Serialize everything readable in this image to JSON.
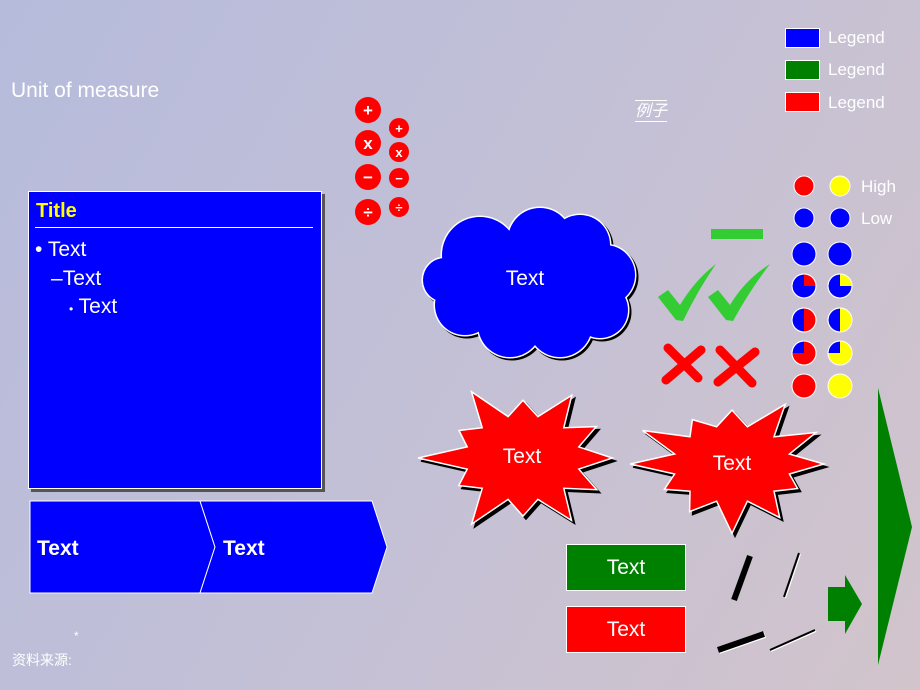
{
  "unit_of_measure": "Unit of measure",
  "example_label": "例子",
  "legend": [
    {
      "label": "Legend",
      "color": "#0000ff"
    },
    {
      "label": "Legend",
      "color": "#008000"
    },
    {
      "label": "Legend",
      "color": "#ff0000"
    }
  ],
  "text_box": {
    "title": "Title",
    "bullets": [
      "Text",
      "Text",
      "Text"
    ]
  },
  "operators": {
    "large": [
      "+",
      "x",
      "−",
      "÷"
    ],
    "small": [
      "+",
      "x",
      "−",
      "÷"
    ]
  },
  "cloud": {
    "label": "Text",
    "color": "#0000ff"
  },
  "stars": [
    {
      "label": "Text"
    },
    {
      "label": "Text"
    }
  ],
  "chevrons": [
    "Text",
    "Text"
  ],
  "buttons": [
    {
      "label": "Text",
      "color": "#008000"
    },
    {
      "label": "Text",
      "color": "#ff0000"
    }
  ],
  "harvey": {
    "high_label": "High",
    "low_label": "Low",
    "levels": [
      0,
      0.25,
      0.5,
      0.75,
      1
    ]
  },
  "colors": {
    "high_left": "#ff0000",
    "high_right": "#ffff00",
    "low": "#0000ff",
    "check": "#33cc33"
  },
  "footer": {
    "asterisk": "*",
    "source_label": "资料来源:"
  }
}
